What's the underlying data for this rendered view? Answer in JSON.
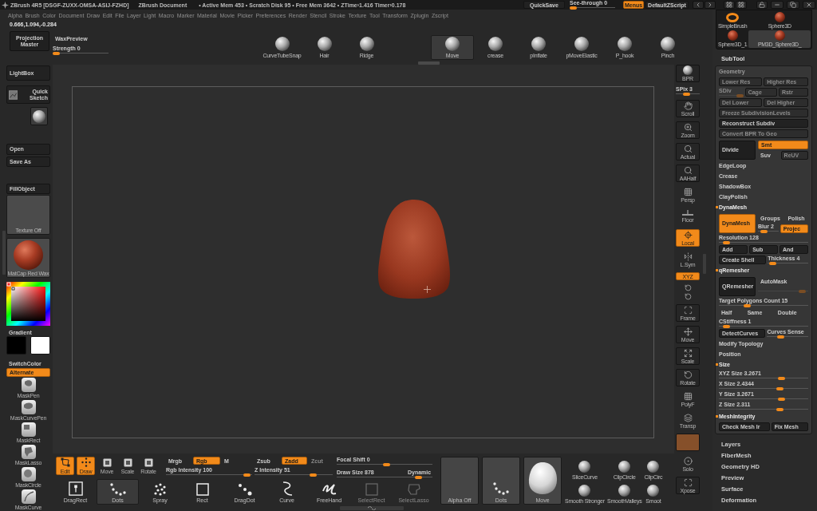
{
  "title_bar": {
    "app": "ZBrush 4R5 [DSGF-ZUXX-OMSA-ASIJ-FZHD]",
    "document": "ZBrush Document",
    "stats": "• Active Mem 453 • Scratch Disk 95 • Free Mem 3642 • ZTime›1.416 Timer›0.178",
    "quicksave": "QuickSave",
    "see_through": {
      "label": "See-through 0",
      "level": 0
    },
    "menus": {
      "label": "Menus",
      "on": true
    },
    "script": "DefaultZScript"
  },
  "menu_bar": [
    "Alpha",
    "Brush",
    "Color",
    "Document",
    "Draw",
    "Edit",
    "File",
    "Layer",
    "Light",
    "Macro",
    "Marker",
    "Material",
    "Movie",
    "Picker",
    "Preferences",
    "Render",
    "Stencil",
    "Stroke",
    "Texture",
    "Tool",
    "Transform",
    "Zplugin",
    "Zscript"
  ],
  "coordinates": "0.666,1.094,-0.284",
  "top_shelf": {
    "projection_master": "Projection Master",
    "wax_preview": "WaxPreview",
    "strength": {
      "label": "Strength 0",
      "level": 0
    },
    "brush_groups": [
      [
        {
          "label": "CurveTubeSnap",
          "selected": false
        },
        {
          "label": "Hair",
          "selected": false
        },
        {
          "label": "Ridge",
          "selected": false
        }
      ],
      [
        {
          "label": "Move",
          "selected": true
        },
        {
          "label": "crease",
          "selected": false
        },
        {
          "label": "pInflate",
          "selected": false
        },
        {
          "label": "pMoveElastic",
          "selected": false
        },
        {
          "label": "P_hook",
          "selected": false
        },
        {
          "label": "Pinch",
          "selected": false
        }
      ]
    ]
  },
  "left_shelf": {
    "lightbox": "LightBox",
    "quick_sketch": "Quick Sketch",
    "file_buttons": [
      "Open",
      "Save As"
    ],
    "fill_object": "FillObject",
    "texture": "Texture Off",
    "material": "MatCap Red Wax",
    "gradient": "Gradient",
    "swatches": [
      {
        "color": "#000000"
      },
      {
        "color": "#ffffff"
      }
    ],
    "switch_color": "SwitchColor",
    "alternate": {
      "label": "Alternate",
      "on": true
    },
    "mask_brushes": [
      "MaskPen",
      "MaskCurvePen",
      "MaskRect",
      "MaskLasso",
      "MaskCircle",
      "MaskCurve"
    ]
  },
  "right_shelf": [
    {
      "kind": "thumb",
      "label": "BPR"
    },
    {
      "kind": "slider",
      "label": "SPix 3",
      "level": 0.45
    },
    {
      "kind": "button",
      "label": "Scroll",
      "on": false
    },
    {
      "kind": "button",
      "label": "Zoom",
      "on": false
    },
    {
      "kind": "button",
      "label": "Actual",
      "on": false
    },
    {
      "kind": "button",
      "label": "AAHalf",
      "on": false
    },
    {
      "kind": "flat",
      "label": "Persp",
      "on": false
    },
    {
      "kind": "flat",
      "label": "Floor",
      "on": false
    },
    {
      "kind": "button",
      "label": "Local",
      "on": true
    },
    {
      "kind": "flat",
      "label": "L.Sym",
      "on": false
    },
    {
      "kind": "small",
      "label": "XYZ",
      "on": true
    },
    {
      "kind": "icons"
    },
    {
      "kind": "button",
      "label": "Frame",
      "on": false
    },
    {
      "kind": "button",
      "label": "Move",
      "on": false
    },
    {
      "kind": "button",
      "label": "Scale",
      "on": false
    },
    {
      "kind": "button",
      "label": "Rotate",
      "on": false
    },
    {
      "kind": "flat",
      "label": "PolyF",
      "on": false
    },
    {
      "kind": "flat",
      "label": "Transp",
      "on": false
    },
    {
      "kind": "blank",
      "on": true
    },
    {
      "kind": "flat",
      "label": "Solo",
      "on": false
    },
    {
      "kind": "button",
      "label": "Xpose",
      "on": false
    }
  ],
  "bottom_shelf": {
    "modes": [
      {
        "label": "Edit",
        "on": true
      },
      {
        "label": "Draw",
        "on": true
      },
      {
        "label": "Move",
        "on": false
      },
      {
        "label": "Scale",
        "on": false
      },
      {
        "label": "Rotate",
        "on": false
      }
    ],
    "color_modes": [
      {
        "label": "Mrgb",
        "on": false
      },
      {
        "label": "Rgb",
        "on": true
      },
      {
        "label": "M",
        "on": false
      }
    ],
    "rgb_intensity": {
      "label": "Rgb Intensity 100",
      "level": 0.98
    },
    "z_modes": [
      {
        "label": "Zsub",
        "on": false,
        "disabled": false
      },
      {
        "label": "Zadd",
        "on": true,
        "disabled": false
      },
      {
        "label": "Zcut",
        "on": false,
        "disabled": true
      }
    ],
    "z_intensity": {
      "label": "Z Intensity 51",
      "level": 0.78
    },
    "focal_shift": {
      "label": "Focal Shift 0",
      "level": 0.52
    },
    "draw_size": {
      "label": "Draw Size 878",
      "level": 0.88
    },
    "dynamic": "Dynamic",
    "strokes": [
      {
        "label": "DragRect",
        "selected": false,
        "disabled": false
      },
      {
        "label": "Dots",
        "selected": true,
        "disabled": false
      },
      {
        "label": "Spray",
        "selected": false,
        "disabled": false
      },
      {
        "label": "Rect",
        "selected": false,
        "disabled": false
      },
      {
        "label": "DragDot",
        "selected": false,
        "disabled": false
      },
      {
        "label": "Curve",
        "selected": false,
        "disabled": false
      },
      {
        "label": "FreeHand",
        "selected": false,
        "disabled": false
      },
      {
        "label": "SelectRect",
        "selected": false,
        "disabled": true
      },
      {
        "label": "SelectLasso",
        "selected": false,
        "disabled": true
      }
    ],
    "thumbnails": [
      {
        "kind": "alpha",
        "label": "Alpha Off"
      },
      {
        "kind": "stroke",
        "label": "Dots"
      },
      {
        "kind": "brush",
        "label": "Move"
      }
    ],
    "brushes": [
      "SliceCurve",
      "ClipCircle",
      "ClipCirc",
      "Smooth Stronger",
      "SmoothValleys",
      "Smoot"
    ]
  },
  "tool_palette": {
    "thumbnails": [
      {
        "kind": "brush",
        "label": "SimpleBrush",
        "selected": false
      },
      {
        "kind": "mesh",
        "label": "Sphere3D",
        "selected": false
      },
      {
        "kind": "mesh",
        "label": "Sphere3D_1",
        "selected": false
      },
      {
        "kind": "mesh",
        "label": "PM3D_Sphere3D_",
        "selected": true
      }
    ]
  },
  "subtool": "SubTool",
  "geometry": {
    "title": "Geometry",
    "rows": [
      {
        "kind": "cells",
        "cells": [
          {
            "kind": "button",
            "label": "Lower Res",
            "on": false,
            "disabled": true
          },
          {
            "kind": "button",
            "label": "Higher Res",
            "on": false,
            "disabled": true
          }
        ]
      },
      {
        "kind": "cells",
        "cells": [
          {
            "kind": "slider",
            "label": "SDiv",
            "level": 1,
            "disabled": true
          },
          {
            "kind": "button",
            "label": "Cage",
            "on": false,
            "disabled": true
          },
          {
            "kind": "button",
            "label": "Rstr",
            "on": false,
            "disabled": true
          }
        ]
      },
      {
        "kind": "cells",
        "cells": [
          {
            "kind": "button",
            "label": "Del Lower",
            "on": false,
            "disabled": true
          },
          {
            "kind": "button",
            "label": "Del Higher",
            "on": false,
            "disabled": true
          }
        ]
      },
      {
        "kind": "cells",
        "cells": [
          {
            "kind": "button",
            "label": "Freeze SubdivisionLevels",
            "on": false,
            "disabled": true
          }
        ]
      },
      {
        "kind": "cells",
        "cells": [
          {
            "kind": "button",
            "label": "Reconstruct Subdiv",
            "on": false,
            "disabled": false
          }
        ]
      },
      {
        "kind": "cells",
        "cells": [
          {
            "kind": "button",
            "label": "Convert BPR To Geo",
            "on": false,
            "disabled": true
          }
        ]
      },
      {
        "kind": "big",
        "button": {
          "label": "Divide",
          "on": false,
          "disabled": false
        },
        "side": [
          [
            {
              "kind": "button",
              "label": "Smt",
              "on": true,
              "disabled": false
            }
          ],
          [
            {
              "kind": "flat",
              "label": "Suv",
              "on": false,
              "disabled": false
            },
            {
              "kind": "button",
              "label": "ReUV",
              "on": false,
              "disabled": true
            }
          ]
        ]
      },
      {
        "kind": "item",
        "label": "EdgeLoop"
      },
      {
        "kind": "item",
        "label": "Crease"
      },
      {
        "kind": "item",
        "label": "ShadowBox"
      },
      {
        "kind": "item",
        "label": "ClayPolish"
      },
      {
        "kind": "header",
        "label": "DynaMesh"
      },
      {
        "kind": "big",
        "button": {
          "label": "DynaMesh",
          "on": true,
          "disabled": false
        },
        "side": [
          [
            {
              "kind": "flat",
              "label": "Groups",
              "on": false,
              "disabled": false
            },
            {
              "kind": "flat",
              "label": "Polish",
              "on": false,
              "disabled": false
            }
          ],
          [
            {
              "kind": "slider",
              "label": "Blur 2",
              "level": 0.2,
              "disabled": false
            },
            {
              "kind": "button",
              "label": "Projec",
              "on": true,
              "disabled": false
            }
          ]
        ]
      },
      {
        "kind": "cells",
        "cells": [
          {
            "kind": "slider",
            "label": "Resolution 128",
            "level": 0.05,
            "disabled": false
          }
        ]
      },
      {
        "kind": "cells",
        "cells": [
          {
            "kind": "button",
            "label": "Add",
            "on": false,
            "disabled": false
          },
          {
            "kind": "button",
            "label": "Sub",
            "on": false,
            "disabled": false
          },
          {
            "kind": "button",
            "label": "And",
            "on": false,
            "disabled": false
          }
        ]
      },
      {
        "kind": "cells",
        "cells": [
          {
            "kind": "button",
            "label": "Create Shell",
            "on": false,
            "disabled": false
          },
          {
            "kind": "slider",
            "label": "Thickness 4",
            "level": 0.05,
            "disabled": false
          }
        ]
      },
      {
        "kind": "header",
        "label": "qRemesher"
      },
      {
        "kind": "big",
        "button": {
          "label": "QRemesher",
          "on": false,
          "disabled": false
        },
        "side": [
          [
            {
              "kind": "flat",
              "label": "AutoMask",
              "on": false,
              "disabled": false
            }
          ],
          [
            {
              "kind": "slider",
              "level": 0.95,
              "disabled": true
            }
          ]
        ]
      },
      {
        "kind": "cells",
        "cells": [
          {
            "kind": "slider",
            "label": "Target Polygons Count 15",
            "level": 0.3,
            "disabled": false
          }
        ]
      },
      {
        "kind": "cells",
        "cells": [
          {
            "kind": "flat",
            "label": "Half",
            "on": false,
            "disabled": false
          },
          {
            "kind": "flat",
            "label": "Same",
            "on": false,
            "disabled": false
          },
          {
            "kind": "flat",
            "label": "Double",
            "on": false,
            "disabled": false
          }
        ]
      },
      {
        "kind": "cells",
        "cells": [
          {
            "kind": "slider",
            "label": "CStiffness 1",
            "level": 0.05,
            "disabled": false
          }
        ]
      },
      {
        "kind": "cells",
        "cells": [
          {
            "kind": "button",
            "label": "DetectCurves",
            "on": false,
            "disabled": false
          },
          {
            "kind": "slider",
            "label": "Curves Sense",
            "level": 0.3,
            "disabled": false
          }
        ]
      },
      {
        "kind": "item",
        "label": "Modify Topology"
      },
      {
        "kind": "item",
        "label": "Position"
      },
      {
        "kind": "header",
        "label": "Size"
      },
      {
        "kind": "cells",
        "cells": [
          {
            "kind": "slider",
            "label": "XYZ Size 3.2671",
            "level": 0.72,
            "disabled": false
          }
        ]
      },
      {
        "kind": "cells",
        "cells": [
          {
            "kind": "slider",
            "label": "X Size 2.4344",
            "level": 0.7,
            "disabled": false
          }
        ]
      },
      {
        "kind": "cells",
        "cells": [
          {
            "kind": "slider",
            "label": "Y Size 3.2671",
            "level": 0.72,
            "disabled": false
          }
        ]
      },
      {
        "kind": "cells",
        "cells": [
          {
            "kind": "slider",
            "label": "Z Size 2.311",
            "level": 0.7,
            "disabled": false
          }
        ]
      },
      {
        "kind": "header",
        "label": "MeshIntegrity"
      },
      {
        "kind": "cells",
        "cells": [
          {
            "kind": "button",
            "label": "Check Mesh Ir",
            "on": false,
            "disabled": false
          },
          {
            "kind": "button",
            "label": "Fix Mesh",
            "on": false,
            "disabled": false
          }
        ]
      }
    ]
  },
  "palettes": [
    "Layers",
    "FiberMesh",
    "Geometry HD",
    "Preview",
    "Surface",
    "Deformation"
  ]
}
